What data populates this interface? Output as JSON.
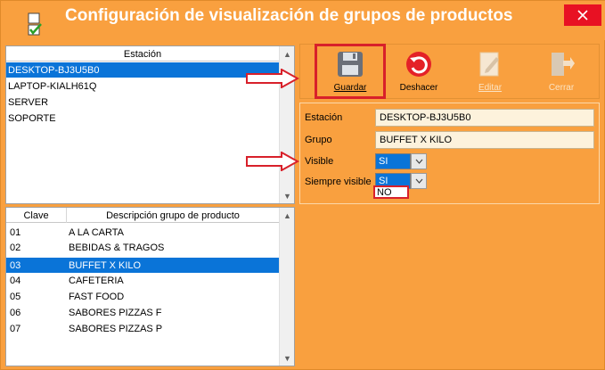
{
  "window": {
    "title": "Configuración de visualización de grupos de productos"
  },
  "stations": {
    "header": "Estación",
    "items": [
      "DESKTOP-BJ3U5B0",
      "LAPTOP-KIALH61Q",
      "SERVER",
      "SOPORTE"
    ],
    "selected_index": 0
  },
  "groups": {
    "headers": {
      "clave": "Clave",
      "descripcion": "Descripción grupo de producto"
    },
    "rows": [
      {
        "clave": "01",
        "descripcion": "A LA CARTA"
      },
      {
        "clave": "02",
        "descripcion": "BEBIDAS & TRAGOS"
      },
      {
        "clave": "03",
        "descripcion": "BUFFET X KILO"
      },
      {
        "clave": "04",
        "descripcion": "CAFETERIA"
      },
      {
        "clave": "05",
        "descripcion": "FAST FOOD"
      },
      {
        "clave": "06",
        "descripcion": "SABORES PIZZAS F"
      },
      {
        "clave": "07",
        "descripcion": "SABORES PIZZAS P"
      }
    ],
    "selected_index": 2
  },
  "toolbar": {
    "guardar": "Guardar",
    "deshacer": "Deshacer",
    "editar": "Editar",
    "cerrar": "Cerrar"
  },
  "details": {
    "estacion_label": "Estación",
    "estacion_value": "DESKTOP-BJ3U5B0",
    "grupo_label": "Grupo",
    "grupo_value": "BUFFET X KILO",
    "visible_label": "Visible",
    "visible_value": "SI",
    "siempre_visible_label": "Siempre visible",
    "siempre_visible_value": "SI",
    "dropdown_option": "NO"
  },
  "colors": {
    "window_bg": "#f9a03f",
    "selection": "#0a74d8",
    "close": "#e81123",
    "highlight": "#d8202a"
  }
}
